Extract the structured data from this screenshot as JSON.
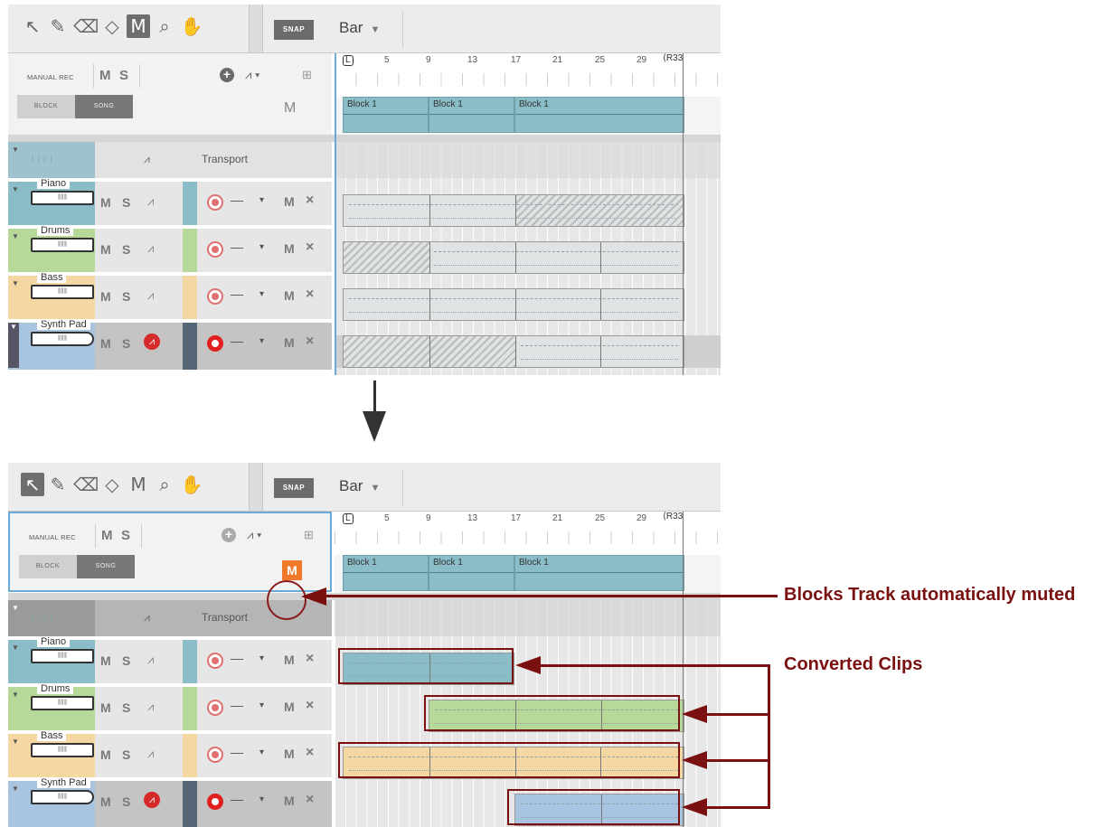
{
  "toolbar": {
    "tools": [
      "pointer-icon",
      "pencil-icon",
      "eraser-icon",
      "paint-icon",
      "mute-tool-icon",
      "zoom-icon",
      "hand-icon"
    ],
    "snap_label": "SNAP",
    "grid_value": "Bar"
  },
  "header": {
    "manual_rec": "MANUAL REC",
    "m": "M",
    "s": "S",
    "block_label": "BLOCK",
    "song_label": "SONG",
    "blocks_mute": "M"
  },
  "ruler": {
    "ticks": [
      "5",
      "9",
      "13",
      "17",
      "21",
      "25",
      "29",
      "33"
    ],
    "left_locator": "L",
    "right_locator": "R"
  },
  "blocks": [
    "Block 1",
    "Block 1",
    "Block 1"
  ],
  "transport": {
    "name": "Transport"
  },
  "tracks": [
    {
      "name": "Piano",
      "color": "#8bbdc8"
    },
    {
      "name": "Drums",
      "color": "#b6d99a"
    },
    {
      "name": "Bass",
      "color": "#f5d7a3"
    },
    {
      "name": "Synth Pad",
      "color": "#a9c4e0"
    }
  ],
  "track_labels": {
    "m": "M",
    "s": "S",
    "mute": "M",
    "remove": "×",
    "dash": "—",
    "drop": "▾"
  },
  "callouts": {
    "blocks_muted": "Blocks Track automatically muted",
    "converted": "Converted Clips"
  },
  "colors": {
    "accent": "#7a1010",
    "mute_orange": "#f07a2a",
    "selection_blue": "#6aa9d8"
  }
}
